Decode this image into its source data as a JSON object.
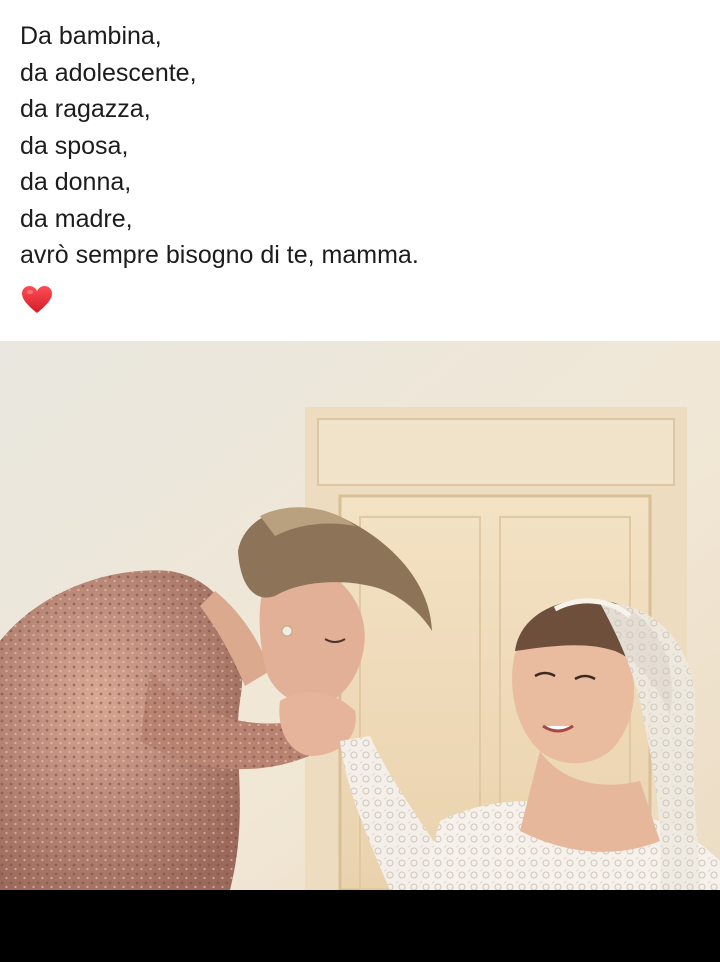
{
  "post": {
    "caption_lines": [
      "Da bambina,",
      "da adolescente,",
      "da ragazza,",
      "da sposa,",
      "da donna,",
      "da madre,",
      "avrò sempre bisogno di te, mamma."
    ],
    "emoji": "heart-emoji",
    "emoji_color": "#e0242e"
  },
  "photo": {
    "subject": "mother-kissing-bride-hand-photo"
  },
  "colors": {
    "background": "#ffffff",
    "text": "#1c1c1c",
    "bottom_bar": "#000000"
  }
}
